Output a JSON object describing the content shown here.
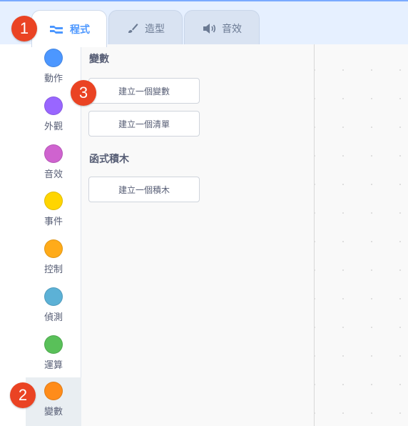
{
  "tabs": [
    {
      "label": "程式",
      "icon": "code-icon",
      "active": true
    },
    {
      "label": "造型",
      "icon": "brush-icon",
      "active": false
    },
    {
      "label": "音效",
      "icon": "speaker-icon",
      "active": false
    }
  ],
  "categories": [
    {
      "label": "動作",
      "color": "#4c97ff"
    },
    {
      "label": "外觀",
      "color": "#9966ff"
    },
    {
      "label": "音效",
      "color": "#cf63cf"
    },
    {
      "label": "事件",
      "color": "#ffd500"
    },
    {
      "label": "控制",
      "color": "#ffab19"
    },
    {
      "label": "偵測",
      "color": "#5cb1d6"
    },
    {
      "label": "運算",
      "color": "#59c059"
    },
    {
      "label": "變數",
      "color": "#ff8c1a",
      "selected": true
    }
  ],
  "palette": {
    "variables_title": "變數",
    "make_variable": "建立一個變數",
    "make_list": "建立一個清單",
    "blocks_title": "函式積木",
    "make_block": "建立一個積木"
  },
  "badges": [
    "1",
    "2",
    "3"
  ]
}
